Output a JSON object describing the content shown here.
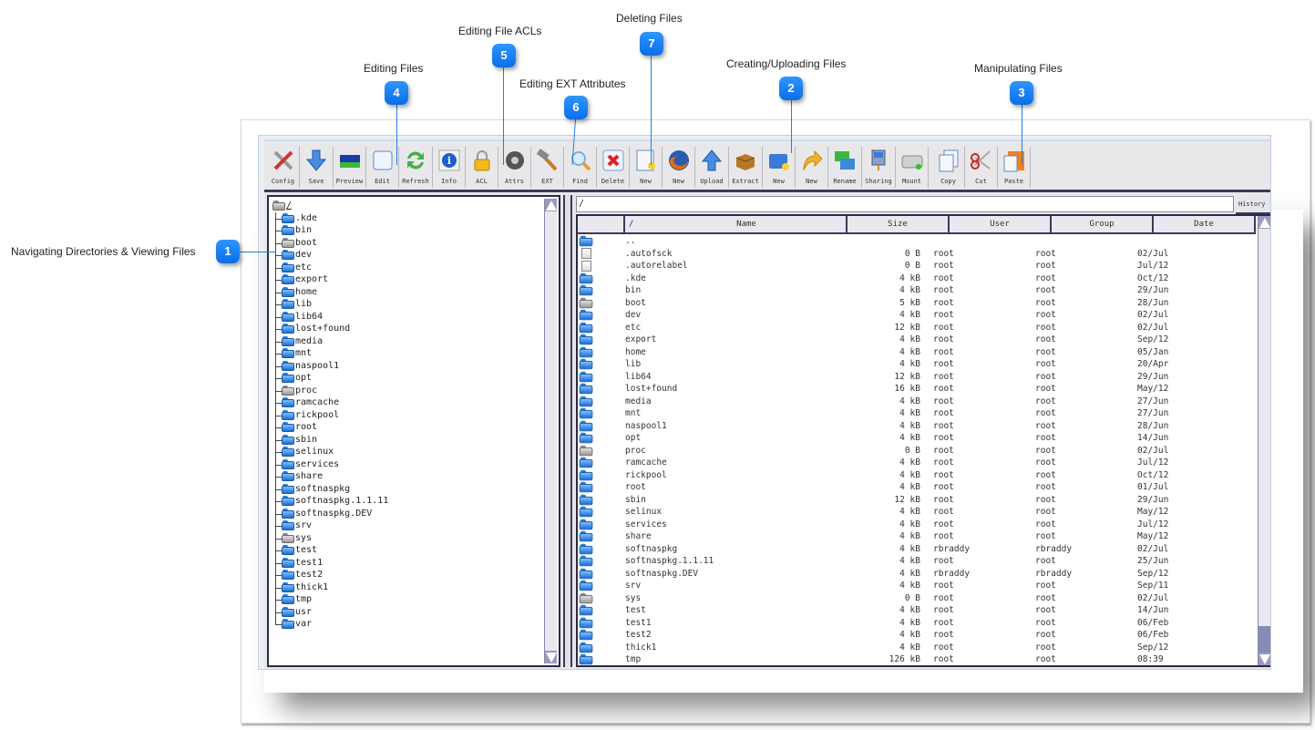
{
  "callouts": [
    {
      "number": "1",
      "label": "Navigating Directories & Viewing Files"
    },
    {
      "number": "2",
      "label": "Creating/Uploading Files"
    },
    {
      "number": "3",
      "label": "Manipulating Files"
    },
    {
      "number": "4",
      "label": "Editing Files"
    },
    {
      "number": "5",
      "label": "Editing File ACLs"
    },
    {
      "number": "6",
      "label": "Editing EXT Attributes"
    },
    {
      "number": "7",
      "label": "Deleting Files"
    }
  ],
  "toolbar": [
    {
      "label": "Config",
      "icon": "tools-icon"
    },
    {
      "label": "Save",
      "icon": "download-arrow-icon"
    },
    {
      "label": "Preview",
      "icon": "preview-image-icon"
    },
    {
      "label": "Edit",
      "icon": "edit-frame-icon"
    },
    {
      "label": "Refresh",
      "icon": "refresh-icon"
    },
    {
      "label": "Info",
      "icon": "info-icon"
    },
    {
      "label": "ACL",
      "icon": "lock-icon"
    },
    {
      "label": "Attrs",
      "icon": "attributes-icon"
    },
    {
      "label": "EXT",
      "icon": "hammer-icon"
    },
    {
      "label": "Find",
      "icon": "magnifier-icon"
    },
    {
      "label": "Delete",
      "icon": "delete-x-icon"
    },
    {
      "label": "New",
      "icon": "new-file-icon"
    },
    {
      "label": "New",
      "icon": "firefox-icon"
    },
    {
      "label": "Upload",
      "icon": "upload-arrow-icon"
    },
    {
      "label": "Extract",
      "icon": "box-icon"
    },
    {
      "label": "New",
      "icon": "new-folder-icon"
    },
    {
      "label": "New",
      "icon": "link-arrow-icon"
    },
    {
      "label": "Rename",
      "icon": "rename-icon"
    },
    {
      "label": "Sharing",
      "icon": "sharing-icon"
    },
    {
      "label": "Mount",
      "icon": "drive-icon"
    },
    {
      "label": "Copy",
      "icon": "copy-icon"
    },
    {
      "label": "Cut",
      "icon": "scissors-icon"
    },
    {
      "label": "Paste",
      "icon": "paste-icon"
    }
  ],
  "tree": {
    "root": "/",
    "items": [
      {
        "name": ".kde",
        "type": "blue"
      },
      {
        "name": "bin",
        "type": "blue"
      },
      {
        "name": "boot",
        "type": "gray"
      },
      {
        "name": "dev",
        "type": "blue"
      },
      {
        "name": "etc",
        "type": "blue"
      },
      {
        "name": "export",
        "type": "blue"
      },
      {
        "name": "home",
        "type": "blue"
      },
      {
        "name": "lib",
        "type": "blue"
      },
      {
        "name": "lib64",
        "type": "blue"
      },
      {
        "name": "lost+found",
        "type": "blue"
      },
      {
        "name": "media",
        "type": "blue"
      },
      {
        "name": "mnt",
        "type": "blue"
      },
      {
        "name": "naspool1",
        "type": "blue"
      },
      {
        "name": "opt",
        "type": "blue"
      },
      {
        "name": "proc",
        "type": "gray"
      },
      {
        "name": "ramcache",
        "type": "blue"
      },
      {
        "name": "rickpool",
        "type": "blue"
      },
      {
        "name": "root",
        "type": "blue"
      },
      {
        "name": "sbin",
        "type": "blue"
      },
      {
        "name": "selinux",
        "type": "blue"
      },
      {
        "name": "services",
        "type": "blue"
      },
      {
        "name": "share",
        "type": "blue"
      },
      {
        "name": "softnaspkg",
        "type": "blue"
      },
      {
        "name": "softnaspkg.1.1.11",
        "type": "blue"
      },
      {
        "name": "softnaspkg.DEV",
        "type": "blue"
      },
      {
        "name": "srv",
        "type": "blue"
      },
      {
        "name": "sys",
        "type": "gray"
      },
      {
        "name": "test",
        "type": "blue"
      },
      {
        "name": "test1",
        "type": "blue"
      },
      {
        "name": "test2",
        "type": "blue"
      },
      {
        "name": "thick1",
        "type": "blue"
      },
      {
        "name": "tmp",
        "type": "blue"
      },
      {
        "name": "usr",
        "type": "blue"
      },
      {
        "name": "var",
        "type": "blue"
      }
    ]
  },
  "path_bar": {
    "value": "/",
    "history_label": "History"
  },
  "file_table": {
    "columns": [
      "/",
      "Name",
      "Size",
      "User",
      "Group",
      "Date"
    ],
    "rows": [
      {
        "icon": "blue",
        "name": "..",
        "size": "",
        "user": "",
        "group": "",
        "date": ""
      },
      {
        "icon": "file",
        "name": ".autofsck",
        "size": "0 B",
        "user": "root",
        "group": "root",
        "date": "02/Jul"
      },
      {
        "icon": "file",
        "name": ".autorelabel",
        "size": "0 B",
        "user": "root",
        "group": "root",
        "date": "Jul/12"
      },
      {
        "icon": "blue",
        "name": ".kde",
        "size": "4 kB",
        "user": "root",
        "group": "root",
        "date": "Oct/12"
      },
      {
        "icon": "blue",
        "name": "bin",
        "size": "4 kB",
        "user": "root",
        "group": "root",
        "date": "29/Jun"
      },
      {
        "icon": "gray",
        "name": "boot",
        "size": "5 kB",
        "user": "root",
        "group": "root",
        "date": "28/Jun"
      },
      {
        "icon": "blue",
        "name": "dev",
        "size": "4 kB",
        "user": "root",
        "group": "root",
        "date": "02/Jul"
      },
      {
        "icon": "blue",
        "name": "etc",
        "size": "12 kB",
        "user": "root",
        "group": "root",
        "date": "02/Jul"
      },
      {
        "icon": "blue",
        "name": "export",
        "size": "4 kB",
        "user": "root",
        "group": "root",
        "date": "Sep/12"
      },
      {
        "icon": "blue",
        "name": "home",
        "size": "4 kB",
        "user": "root",
        "group": "root",
        "date": "05/Jan"
      },
      {
        "icon": "blue",
        "name": "lib",
        "size": "4 kB",
        "user": "root",
        "group": "root",
        "date": "20/Apr"
      },
      {
        "icon": "blue",
        "name": "lib64",
        "size": "12 kB",
        "user": "root",
        "group": "root",
        "date": "29/Jun"
      },
      {
        "icon": "blue",
        "name": "lost+found",
        "size": "16 kB",
        "user": "root",
        "group": "root",
        "date": "May/12"
      },
      {
        "icon": "blue",
        "name": "media",
        "size": "4 kB",
        "user": "root",
        "group": "root",
        "date": "27/Jun"
      },
      {
        "icon": "blue",
        "name": "mnt",
        "size": "4 kB",
        "user": "root",
        "group": "root",
        "date": "27/Jun"
      },
      {
        "icon": "blue",
        "name": "naspool1",
        "size": "4 kB",
        "user": "root",
        "group": "root",
        "date": "28/Jun"
      },
      {
        "icon": "blue",
        "name": "opt",
        "size": "4 kB",
        "user": "root",
        "group": "root",
        "date": "14/Jun"
      },
      {
        "icon": "gray",
        "name": "proc",
        "size": "0 B",
        "user": "root",
        "group": "root",
        "date": "02/Jul"
      },
      {
        "icon": "blue",
        "name": "ramcache",
        "size": "4 kB",
        "user": "root",
        "group": "root",
        "date": "Jul/12"
      },
      {
        "icon": "blue",
        "name": "rickpool",
        "size": "4 kB",
        "user": "root",
        "group": "root",
        "date": "Oct/12"
      },
      {
        "icon": "blue",
        "name": "root",
        "size": "4 kB",
        "user": "root",
        "group": "root",
        "date": "01/Jul"
      },
      {
        "icon": "blue",
        "name": "sbin",
        "size": "12 kB",
        "user": "root",
        "group": "root",
        "date": "29/Jun"
      },
      {
        "icon": "blue",
        "name": "selinux",
        "size": "4 kB",
        "user": "root",
        "group": "root",
        "date": "May/12"
      },
      {
        "icon": "blue",
        "name": "services",
        "size": "4 kB",
        "user": "root",
        "group": "root",
        "date": "Jul/12"
      },
      {
        "icon": "blue",
        "name": "share",
        "size": "4 kB",
        "user": "root",
        "group": "root",
        "date": "May/12"
      },
      {
        "icon": "blue",
        "name": "softnaspkg",
        "size": "4 kB",
        "user": "rbraddy",
        "group": "rbraddy",
        "date": "02/Jul"
      },
      {
        "icon": "blue",
        "name": "softnaspkg.1.1.11",
        "size": "4 kB",
        "user": "root",
        "group": "root",
        "date": "25/Jun"
      },
      {
        "icon": "blue",
        "name": "softnaspkg.DEV",
        "size": "4 kB",
        "user": "rbraddy",
        "group": "rbraddy",
        "date": "Sep/12"
      },
      {
        "icon": "blue",
        "name": "srv",
        "size": "4 kB",
        "user": "root",
        "group": "root",
        "date": "Sep/11"
      },
      {
        "icon": "gray",
        "name": "sys",
        "size": "0 B",
        "user": "root",
        "group": "root",
        "date": "02/Jul"
      },
      {
        "icon": "blue",
        "name": "test",
        "size": "4 kB",
        "user": "root",
        "group": "root",
        "date": "14/Jun"
      },
      {
        "icon": "blue",
        "name": "test1",
        "size": "4 kB",
        "user": "root",
        "group": "root",
        "date": "06/Feb"
      },
      {
        "icon": "blue",
        "name": "test2",
        "size": "4 kB",
        "user": "root",
        "group": "root",
        "date": "06/Feb"
      },
      {
        "icon": "blue",
        "name": "thick1",
        "size": "4 kB",
        "user": "root",
        "group": "root",
        "date": "Sep/12"
      },
      {
        "icon": "blue",
        "name": "tmp",
        "size": "126 kB",
        "user": "root",
        "group": "root",
        "date": "08:39"
      }
    ]
  },
  "colors": {
    "badge": "#1a82f7",
    "callout_line": "#1e7fe0",
    "pane_border": "#2a2a44",
    "scrollbar": "#9a9ac0"
  }
}
